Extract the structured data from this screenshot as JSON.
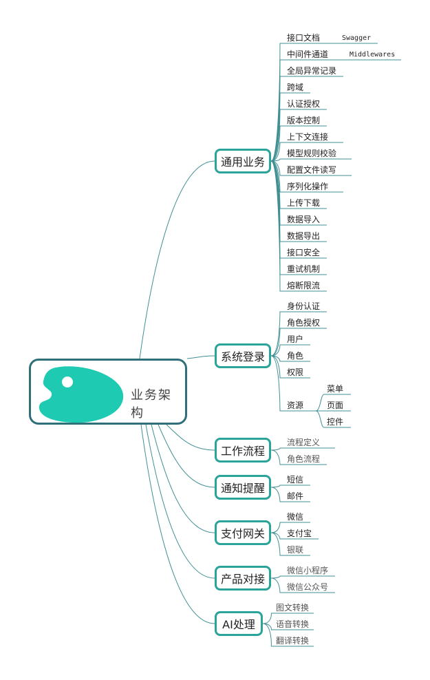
{
  "root": {
    "title": "业务架构"
  },
  "categories": [
    {
      "label": "通用业务",
      "items": [
        "接口文档",
        "中间件通道",
        "全局异常记录",
        "跨域",
        "认证授权",
        "版本控制",
        "上下文连接",
        "模型规则校验",
        "配置文件读写",
        "序列化操作",
        "上传下载",
        "数据导入",
        "数据导出",
        "接口安全",
        "重试机制",
        "熔断限流"
      ],
      "notes": [
        "Swagger",
        "Middlewares"
      ]
    },
    {
      "label": "系统登录",
      "items": [
        "身份认证",
        "角色授权",
        "用户",
        "角色",
        "权限",
        "资源"
      ],
      "sub_items": [
        "菜单",
        "页面",
        "控件"
      ]
    },
    {
      "label": "工作流程",
      "items": [
        "流程定义",
        "角色流程"
      ]
    },
    {
      "label": "通知提醒",
      "items": [
        "短信",
        "邮件"
      ]
    },
    {
      "label": "支付网关",
      "items": [
        "微信",
        "支付宝",
        "银联"
      ]
    },
    {
      "label": "产品对接",
      "items": [
        "微信小程序",
        "微信公众号"
      ]
    },
    {
      "label": "AI处理",
      "items": [
        "图文转换",
        "语音转换",
        "翻译转换"
      ]
    }
  ],
  "colors": {
    "branch": "#3f8f93",
    "cat_border": "#2aa39a",
    "root_border": "#2f6f7a",
    "blob": "#1ecbb2"
  }
}
